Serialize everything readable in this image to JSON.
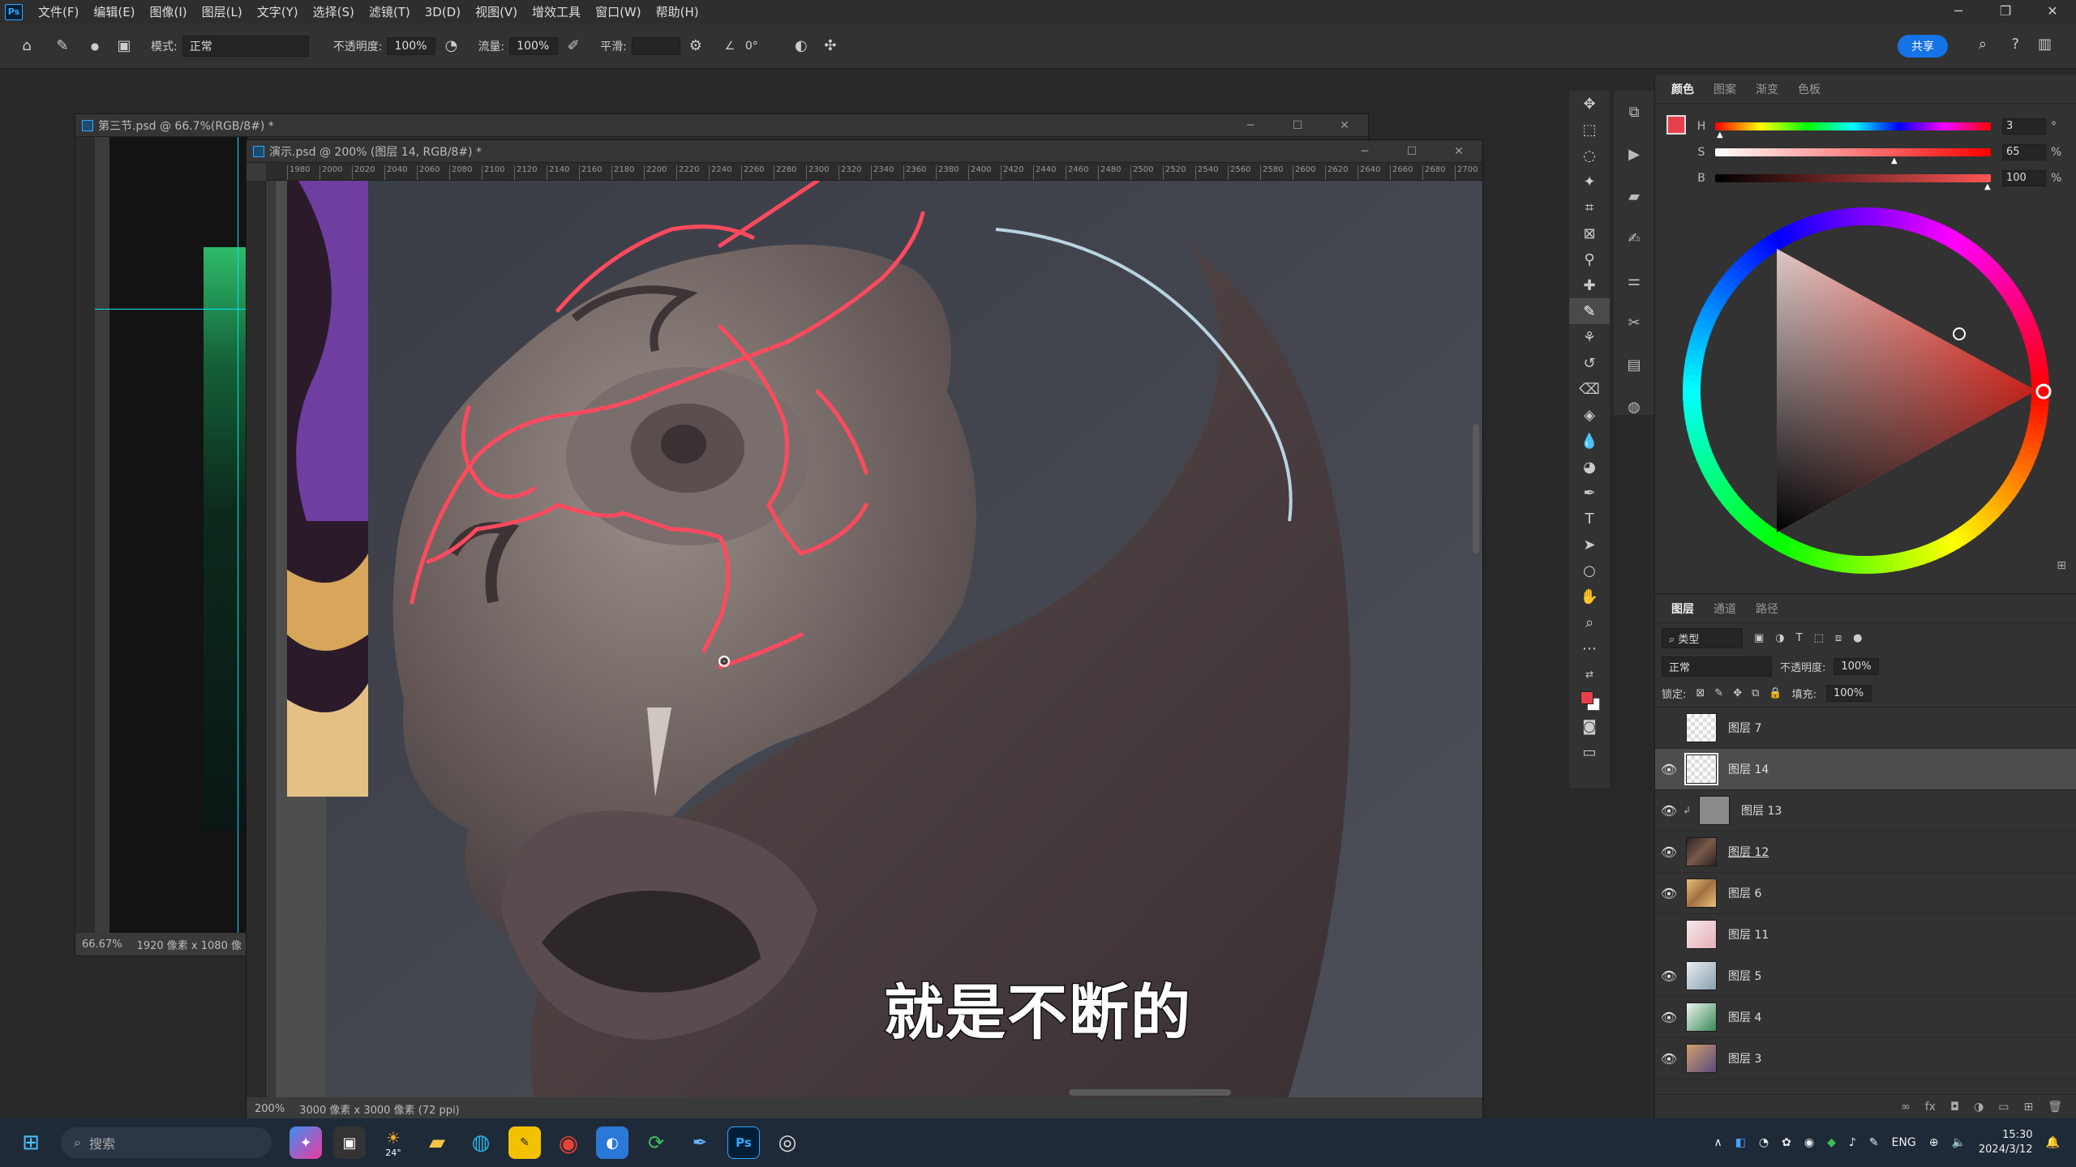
{
  "menu": {
    "items": [
      "文件(F)",
      "编辑(E)",
      "图像(I)",
      "图层(L)",
      "文字(Y)",
      "选择(S)",
      "滤镜(T)",
      "3D(D)",
      "视图(V)",
      "增效工具",
      "窗口(W)",
      "帮助(H)"
    ]
  },
  "options": {
    "mode_label": "模式:",
    "mode_value": "正常",
    "opacity_label": "不透明度:",
    "opacity_value": "100%",
    "flow_label": "流量:",
    "flow_value": "100%",
    "smooth_label": "平滑:",
    "angle_value": "0°",
    "share_label": "共享"
  },
  "doc1": {
    "title": "第三节.psd @ 66.7%(RGB/8#) *",
    "zoom": "66.67%",
    "size": "1920 像素 x 1080 像"
  },
  "doc2": {
    "title": "演示.psd @ 200% (图层 14, RGB/8#) *",
    "zoom": "200%",
    "size": "3000 像素 x 3000 像素 (72 ppi)"
  },
  "ruler_ticks": [
    "1980",
    "2000",
    "2020",
    "2040",
    "2060",
    "2080",
    "2100",
    "2120",
    "2140",
    "2160",
    "2180",
    "2200",
    "2220",
    "2240",
    "2260",
    "2280",
    "2300",
    "2320",
    "2340",
    "2360",
    "2380",
    "2400",
    "2420",
    "2440",
    "2460",
    "2480",
    "2500",
    "2520",
    "2540",
    "2560",
    "2580",
    "2600",
    "2620",
    "2640",
    "2660",
    "2680",
    "2700"
  ],
  "subtitle": "就是不断的",
  "color_panel": {
    "tabs": [
      "颜色",
      "图案",
      "渐变",
      "色板"
    ],
    "h_label": "H",
    "h_value": "3",
    "s_label": "S",
    "s_value": "65",
    "b_label": "B",
    "b_value": "100",
    "percent": "%",
    "degree": "°",
    "fg_color": "#e8404a"
  },
  "layers_panel": {
    "tabs": [
      "图层",
      "通道",
      "路径"
    ],
    "filter_label": "类型",
    "blend": "正常",
    "opacity_label": "不透明度:",
    "opacity_value": "100%",
    "lock_label": "锁定:",
    "fill_label": "填充:",
    "fill_value": "100%",
    "layers": [
      {
        "name": "图层 7",
        "visible": false
      },
      {
        "name": "图层 14",
        "visible": true
      },
      {
        "name": "图层 13",
        "visible": true
      },
      {
        "name": "图层 12",
        "visible": true
      },
      {
        "name": "图层 6",
        "visible": true
      },
      {
        "name": "图层 11",
        "visible": false
      },
      {
        "name": "图层 5",
        "visible": true
      },
      {
        "name": "图层 4",
        "visible": true
      },
      {
        "name": "图层 3",
        "visible": true
      }
    ]
  },
  "taskbar": {
    "search_placeholder": "搜索",
    "weather": "24°",
    "lang": "ENG",
    "time": "15:30",
    "date": "2024/3/12"
  }
}
